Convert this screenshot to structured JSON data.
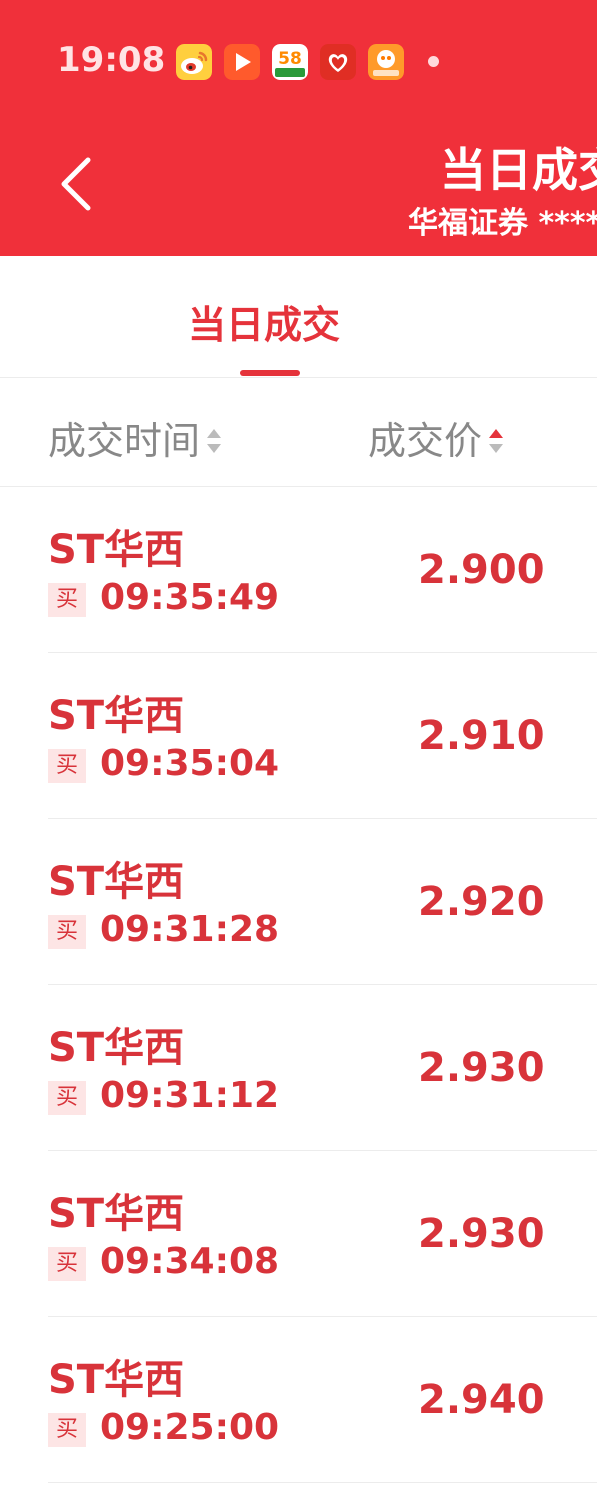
{
  "status_bar": {
    "time": "19:08",
    "icons": [
      "weibo-app-icon",
      "video-player-app-icon",
      "58-app-icon",
      "pinduoduo-app-icon",
      "service-festival-app-icon"
    ]
  },
  "header": {
    "title": "当日成交",
    "subtitle": "华福证券 ****"
  },
  "tabs": [
    {
      "label": "当日成交",
      "active": true
    }
  ],
  "columns": {
    "time": "成交时间",
    "price": "成交价"
  },
  "trades": [
    {
      "name": "ST华西",
      "side": "买",
      "time": "09:35:49",
      "price": "2.900"
    },
    {
      "name": "ST华西",
      "side": "买",
      "time": "09:35:04",
      "price": "2.910"
    },
    {
      "name": "ST华西",
      "side": "买",
      "time": "09:31:28",
      "price": "2.920"
    },
    {
      "name": "ST华西",
      "side": "买",
      "time": "09:31:12",
      "price": "2.930"
    },
    {
      "name": "ST华西",
      "side": "买",
      "time": "09:34:08",
      "price": "2.930"
    },
    {
      "name": "ST华西",
      "side": "买",
      "time": "09:25:00",
      "price": "2.940"
    }
  ],
  "colors": {
    "header_bg": "#f0303a",
    "accent_red": "#e5333b",
    "text_red": "#d8333a",
    "muted_gray": "#888888"
  }
}
